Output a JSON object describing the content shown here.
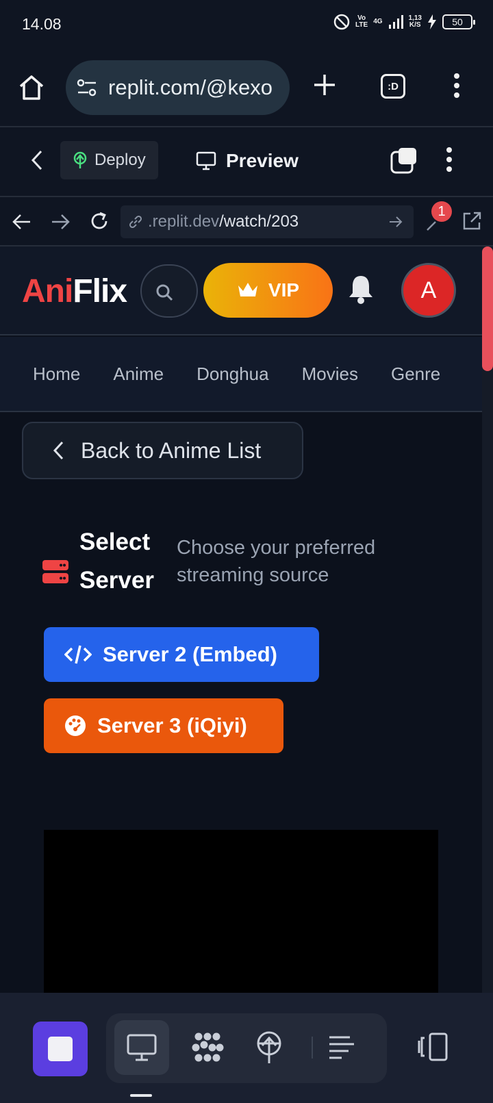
{
  "status": {
    "time": "14.08",
    "net_volte": "Vo\nLTE",
    "net_4g": "4G",
    "speed": "1,13\nK/S",
    "battery": "50"
  },
  "browser": {
    "url": "replit.com/@kexo"
  },
  "replit": {
    "deploy_label": "Deploy",
    "preview_label": "Preview"
  },
  "address": {
    "host": ".replit.dev",
    "path": "/watch/203",
    "devtools_badge": "1"
  },
  "site": {
    "logo_part1": "Ani",
    "logo_part2": "Flix",
    "vip_label": "VIP",
    "avatar_letter": "A",
    "nav": [
      "Home",
      "Anime",
      "Donghua",
      "Movies",
      "Genre"
    ],
    "back_label": "Back to Anime List",
    "select_title": "Select Server",
    "select_subtitle": "Choose your preferred streaming source",
    "servers": [
      "Server 2 (Embed)",
      "Server 3 (iQiyi)"
    ]
  },
  "colors": {
    "accent_red": "#ef4444",
    "server2": "#2563eb",
    "server3": "#ea580c",
    "stop_button": "#5b3ee0"
  },
  "icons": {
    "bottom_tools": [
      "monitor-icon",
      "ai-agent-icon",
      "deploy-icon",
      "console-icon",
      "layout-icon"
    ]
  }
}
